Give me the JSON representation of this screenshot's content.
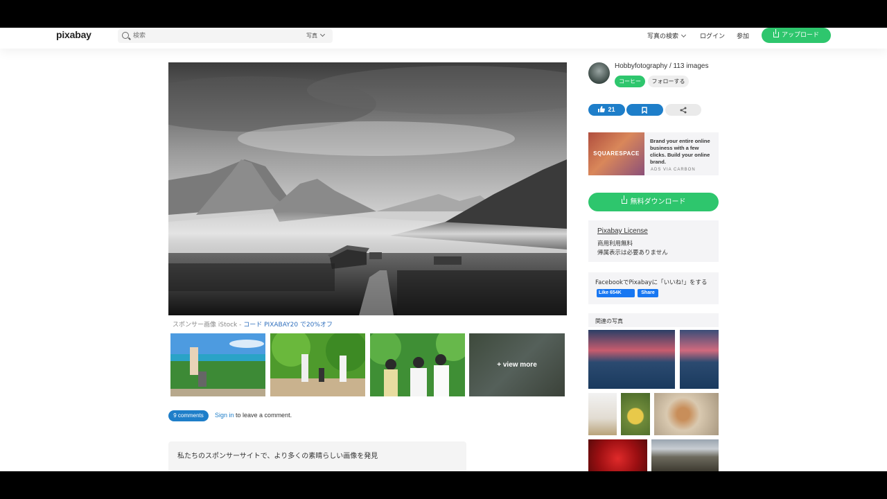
{
  "header": {
    "logo": "pixabay",
    "search_placeholder": "検索",
    "search_type": "写真",
    "nav": {
      "explore": "写真の検索",
      "login": "ログイン",
      "join": "参加",
      "upload": "アップロード"
    }
  },
  "main": {
    "sponsor_prefix": "スポンサー画像 iStock - ",
    "sponsor_code": "コード PIXABAY20 で20%オフ",
    "view_more": "+ view more",
    "comments": {
      "count_label": "9 comments",
      "sign_in": "Sign in",
      "sign_in_suffix": " to leave a comment."
    },
    "discover": "私たちのスポンサーサイトで、より多くの素晴らしい画像を発見"
  },
  "sidebar": {
    "author": "Hobbyfotography / 113 images",
    "coffee": "コーヒー",
    "follow": "フォローする",
    "likes": "21",
    "ad": {
      "brand": "SQUARESPACE",
      "text": "Brand your entire online business with a few clicks. Build your online brand.",
      "via": "ADS VIA CARBON"
    },
    "download": "無料ダウンロード",
    "license": {
      "title": "Pixabay License",
      "line1": "商用利用無料",
      "line2": "帰属表示は必要ありません"
    },
    "facebook": {
      "text": "FacebookでPixabayに「いいね!」をする",
      "like": "Like 654K",
      "share": "Share"
    },
    "related_title": "関連の写真"
  },
  "colors": {
    "green": "#2ec66d",
    "blue": "#1e7ec9",
    "link_blue": "#2f6fbd",
    "fb_blue": "#1877f2"
  }
}
